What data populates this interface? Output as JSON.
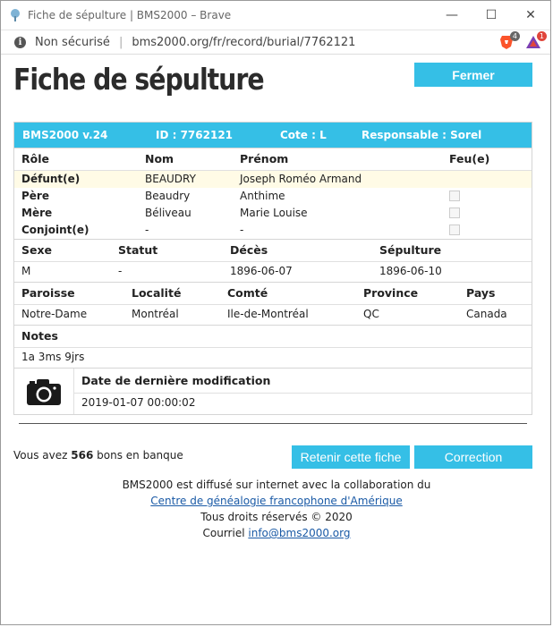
{
  "window": {
    "title": "Fiche de sépulture | BMS2000 – Brave"
  },
  "address_bar": {
    "security_text": "Non sécurisé",
    "url": "bms2000.org/fr/record/burial/7762121",
    "brave_badge": "4",
    "rewards_badge": "1"
  },
  "page": {
    "heading": "Fiche de sépulture",
    "close_label": "Fermer"
  },
  "record": {
    "header": {
      "version": "BMS2000 v.24",
      "id": "ID : 7762121",
      "cote": "Cote : L",
      "responsable": "Responsable : Sorel"
    },
    "persons": {
      "headers": {
        "role": "Rôle",
        "nom": "Nom",
        "prenom": "Prénom",
        "feu": "Feu(e)"
      },
      "rows": [
        {
          "role": "Défunt(e)",
          "nom": "BEAUDRY",
          "prenom": "Joseph Roméo Armand",
          "feu": null
        },
        {
          "role": "Père",
          "nom": "Beaudry",
          "prenom": "Anthime",
          "feu": false
        },
        {
          "role": "Mère",
          "nom": "Béliveau",
          "prenom": "Marie Louise",
          "feu": false
        },
        {
          "role": "Conjoint(e)",
          "nom": "-",
          "prenom": "-",
          "feu": false
        }
      ]
    },
    "event": {
      "headers": {
        "sexe": "Sexe",
        "statut": "Statut",
        "deces": "Décès",
        "sepulture": "Sépulture"
      },
      "values": {
        "sexe": "M",
        "statut": "-",
        "deces": "1896-06-07",
        "sepulture": "1896-06-10"
      }
    },
    "place": {
      "headers": {
        "paroisse": "Paroisse",
        "localite": "Localité",
        "comte": "Comté",
        "province": "Province",
        "pays": "Pays"
      },
      "values": {
        "paroisse": "Notre-Dame",
        "localite": "Montréal",
        "comte": "Ile-de-Montréal",
        "province": "QC",
        "pays": "Canada"
      }
    },
    "notes": {
      "header": "Notes",
      "value": "1a 3ms 9jrs"
    },
    "modification": {
      "header": "Date de dernière modification",
      "value": "2019-01-07 00:00:02"
    }
  },
  "bank": {
    "prefix": "Vous avez",
    "count": "566",
    "suffix": "bons en banque"
  },
  "actions": {
    "retenir_label": "Retenir cette fiche",
    "correction_label": "Correction"
  },
  "footer": {
    "line1": "BMS2000 est diffusé sur internet avec la collaboration du",
    "link_text": "Centre de généalogie francophone d'Amérique",
    "rights": "Tous droits réservés © 2020",
    "email_label": "Courriel",
    "email": "info@bms2000.org"
  },
  "colors": {
    "accent": "#35bfe6",
    "highlight_row": "#fffbe6",
    "link": "#1a5aa6"
  }
}
